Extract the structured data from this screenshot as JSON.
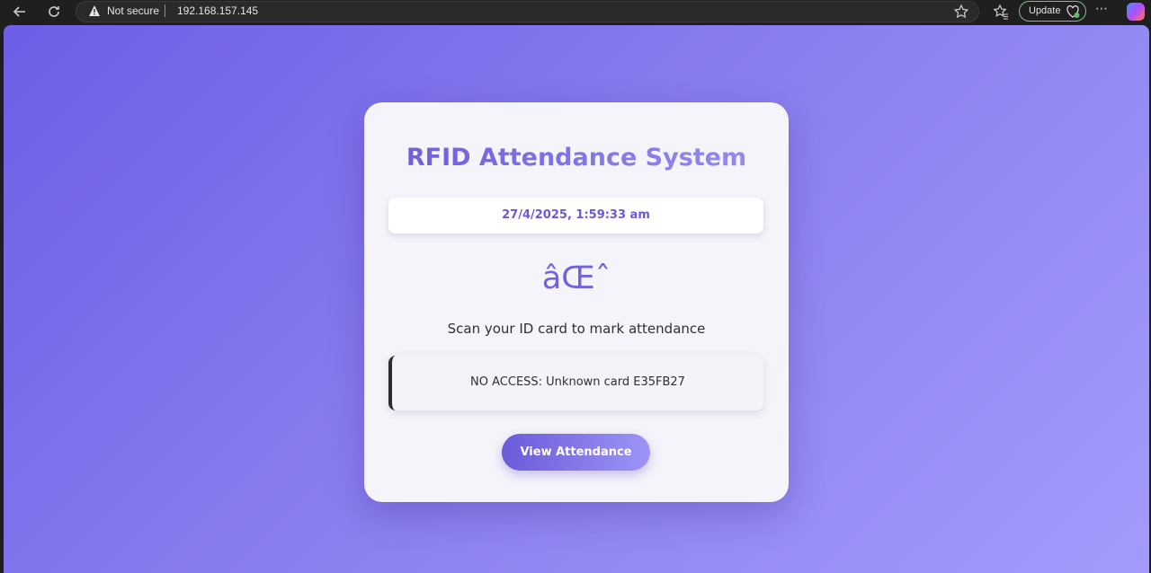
{
  "browser": {
    "security_label": "Not secure",
    "url": "192.168.157.145",
    "update_label": "Update",
    "menu_label": "⋯"
  },
  "page": {
    "title": "RFID Attendance System",
    "datetime": "27/4/2025, 1:59:33 am",
    "glyph": "âŒˆ",
    "prompt": "Scan your ID card to mark attendance",
    "status_message": "NO ACCESS: Unknown card E35FB27",
    "view_button_label": "View Attendance"
  },
  "colors": {
    "accent": "#6a5ad9",
    "background_start": "#6d5fe6",
    "background_end": "#a39bfb",
    "card": "#f5f4fa"
  }
}
